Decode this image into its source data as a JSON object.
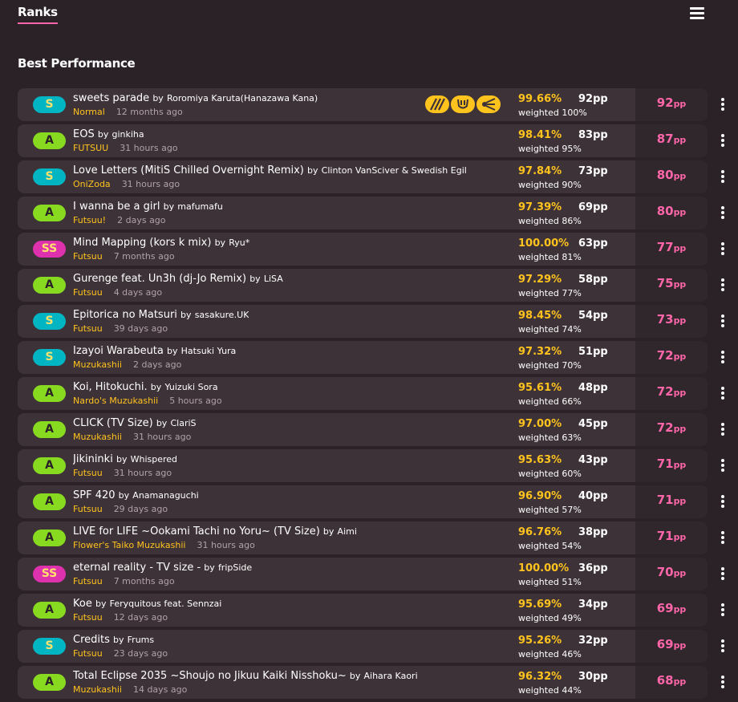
{
  "header": {
    "tab_ranks": "Ranks",
    "menu_icon": "hamburger-menu-icon"
  },
  "section": {
    "title": "Best Performance"
  },
  "colors": {
    "accent_pink": "#ff66aa",
    "accuracy_yellow": "#ffc31e",
    "grade_A": "#88da20",
    "grade_S": "#02b5c3",
    "grade_SS": "#de31ae"
  },
  "scores": [
    {
      "grade": "S",
      "title": "sweets parade",
      "by": "by",
      "artist": "Roromiya Karuta(Hanazawa Kana)",
      "difficulty": "Normal",
      "ago": "12 months ago",
      "mods": [
        "mod-icon-hidden",
        "mod-icon-hardrock",
        "mod-icon-flashlight"
      ],
      "accuracy": "99.66%",
      "pp": "92",
      "weighted_label": "weighted",
      "weight": "100%",
      "weighted_pp": "92",
      "pp_unit": "pp"
    },
    {
      "grade": "A",
      "title": "EOS",
      "by": "by",
      "artist": "ginkiha",
      "difficulty": "FUTSUU",
      "ago": "31 hours ago",
      "mods": [],
      "accuracy": "98.41%",
      "pp": "83",
      "weighted_label": "weighted",
      "weight": "95%",
      "weighted_pp": "87",
      "pp_unit": "pp"
    },
    {
      "grade": "S",
      "title": "Love Letters (MitiS Chilled Overnight Remix)",
      "by": "by",
      "artist": "Clinton VanSciver & Swedish Egil",
      "difficulty": "OniZoda",
      "ago": "31 hours ago",
      "mods": [],
      "accuracy": "97.84%",
      "pp": "73",
      "weighted_label": "weighted",
      "weight": "90%",
      "weighted_pp": "80",
      "pp_unit": "pp"
    },
    {
      "grade": "A",
      "title": "I wanna be a girl",
      "by": "by",
      "artist": "mafumafu",
      "difficulty": "Futsuu!",
      "ago": "2 days ago",
      "mods": [],
      "accuracy": "97.39%",
      "pp": "69",
      "weighted_label": "weighted",
      "weight": "86%",
      "weighted_pp": "80",
      "pp_unit": "pp"
    },
    {
      "grade": "SS",
      "title": "Mind Mapping (kors k mix)",
      "by": "by",
      "artist": "Ryu*",
      "difficulty": "Futsuu",
      "ago": "7 months ago",
      "mods": [],
      "accuracy": "100.00%",
      "pp": "63",
      "weighted_label": "weighted",
      "weight": "81%",
      "weighted_pp": "77",
      "pp_unit": "pp"
    },
    {
      "grade": "A",
      "title": "Gurenge feat. Un3h (dj-Jo Remix)",
      "by": "by",
      "artist": "LiSA",
      "difficulty": "Futsuu",
      "ago": "4 days ago",
      "mods": [],
      "accuracy": "97.29%",
      "pp": "58",
      "weighted_label": "weighted",
      "weight": "77%",
      "weighted_pp": "75",
      "pp_unit": "pp"
    },
    {
      "grade": "S",
      "title": "Epitorica no Matsuri",
      "by": "by",
      "artist": "sasakure.UK",
      "difficulty": "Futsuu",
      "ago": "39 days ago",
      "mods": [],
      "accuracy": "98.45%",
      "pp": "54",
      "weighted_label": "weighted",
      "weight": "74%",
      "weighted_pp": "73",
      "pp_unit": "pp"
    },
    {
      "grade": "S",
      "title": "Izayoi Warabeuta",
      "by": "by",
      "artist": "Hatsuki Yura",
      "difficulty": "Muzukashii",
      "ago": "2 days ago",
      "mods": [],
      "accuracy": "97.32%",
      "pp": "51",
      "weighted_label": "weighted",
      "weight": "70%",
      "weighted_pp": "72",
      "pp_unit": "pp"
    },
    {
      "grade": "A",
      "title": "Koi, Hitokuchi.",
      "by": "by",
      "artist": "Yuizuki Sora",
      "difficulty": "Nardo's Muzukashii",
      "ago": "5 hours ago",
      "mods": [],
      "accuracy": "95.61%",
      "pp": "48",
      "weighted_label": "weighted",
      "weight": "66%",
      "weighted_pp": "72",
      "pp_unit": "pp"
    },
    {
      "grade": "A",
      "title": "CLICK (TV Size)",
      "by": "by",
      "artist": "ClariS",
      "difficulty": "Muzukashii",
      "ago": "31 hours ago",
      "mods": [],
      "accuracy": "97.00%",
      "pp": "45",
      "weighted_label": "weighted",
      "weight": "63%",
      "weighted_pp": "72",
      "pp_unit": "pp"
    },
    {
      "grade": "A",
      "title": "Jikininki",
      "by": "by",
      "artist": "Whispered",
      "difficulty": "Futsuu",
      "ago": "31 hours ago",
      "mods": [],
      "accuracy": "95.63%",
      "pp": "43",
      "weighted_label": "weighted",
      "weight": "60%",
      "weighted_pp": "71",
      "pp_unit": "pp"
    },
    {
      "grade": "A",
      "title": "SPF 420",
      "by": "by",
      "artist": "Anamanaguchi",
      "difficulty": "Futsuu",
      "ago": "29 days ago",
      "mods": [],
      "accuracy": "96.90%",
      "pp": "40",
      "weighted_label": "weighted",
      "weight": "57%",
      "weighted_pp": "71",
      "pp_unit": "pp"
    },
    {
      "grade": "A",
      "title": "LIVE for LIFE ~Ookami Tachi no Yoru~ (TV Size)",
      "by": "by",
      "artist": "Aimi",
      "difficulty": "Flower's Taiko Muzukashii",
      "ago": "31 hours ago",
      "mods": [],
      "accuracy": "96.76%",
      "pp": "38",
      "weighted_label": "weighted",
      "weight": "54%",
      "weighted_pp": "71",
      "pp_unit": "pp"
    },
    {
      "grade": "SS",
      "title": "eternal reality - TV size -",
      "by": "by",
      "artist": "fripSide",
      "difficulty": "Futsuu",
      "ago": "7 months ago",
      "mods": [],
      "accuracy": "100.00%",
      "pp": "36",
      "weighted_label": "weighted",
      "weight": "51%",
      "weighted_pp": "70",
      "pp_unit": "pp"
    },
    {
      "grade": "A",
      "title": "Koe",
      "by": "by",
      "artist": "Feryquitous feat. Sennzai",
      "difficulty": "Futsuu",
      "ago": "12 days ago",
      "mods": [],
      "accuracy": "95.69%",
      "pp": "34",
      "weighted_label": "weighted",
      "weight": "49%",
      "weighted_pp": "69",
      "pp_unit": "pp"
    },
    {
      "grade": "S",
      "title": "Credits",
      "by": "by",
      "artist": "Frums",
      "difficulty": "Futsuu",
      "ago": "23 days ago",
      "mods": [],
      "accuracy": "95.26%",
      "pp": "32",
      "weighted_label": "weighted",
      "weight": "46%",
      "weighted_pp": "69",
      "pp_unit": "pp"
    },
    {
      "grade": "A",
      "title": "Total Eclipse 2035 ~Shoujo no Jikuu Kaiki Nisshoku~",
      "by": "by",
      "artist": "Aihara Kaori",
      "difficulty": "Muzukashii",
      "ago": "14 days ago",
      "mods": [],
      "accuracy": "96.32%",
      "pp": "30",
      "weighted_label": "weighted",
      "weight": "44%",
      "weighted_pp": "68",
      "pp_unit": "pp"
    }
  ]
}
